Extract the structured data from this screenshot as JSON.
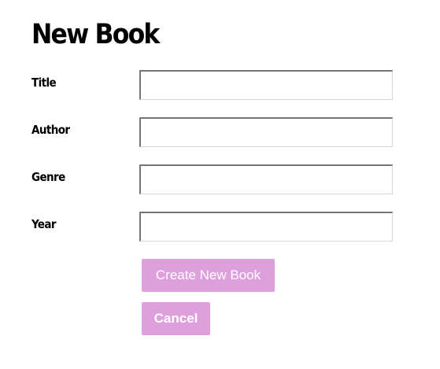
{
  "page": {
    "title": "New Book"
  },
  "form": {
    "fields": [
      {
        "label": "Title",
        "value": "",
        "placeholder": ""
      },
      {
        "label": "Author",
        "value": "",
        "placeholder": ""
      },
      {
        "label": "Genre",
        "value": "",
        "placeholder": ""
      },
      {
        "label": "Year",
        "value": "",
        "placeholder": ""
      }
    ],
    "submit_label": "Create New Book",
    "cancel_label": "Cancel"
  },
  "colors": {
    "button_background": "#dda0dd",
    "button_text": "#ffffff",
    "label_text": "#000000"
  }
}
